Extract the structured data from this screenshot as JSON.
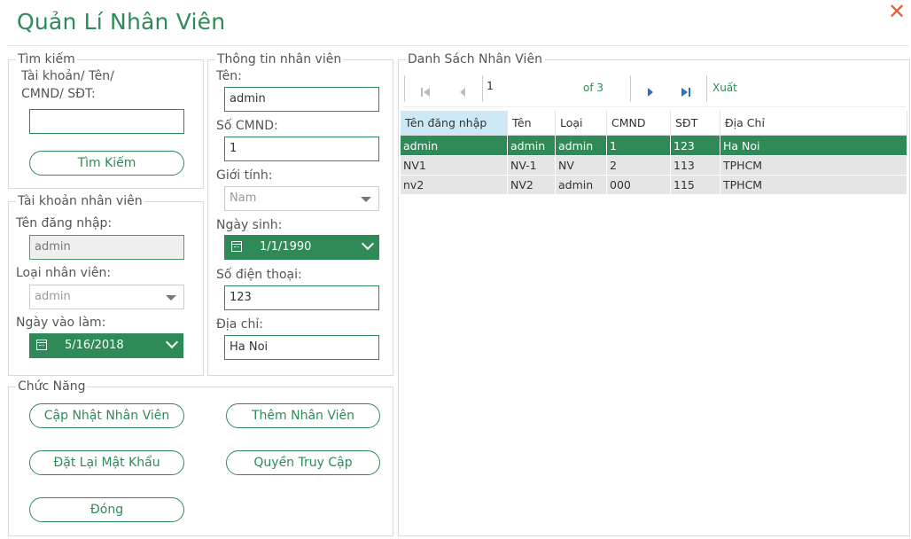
{
  "window": {
    "title": "Quản Lí Nhân Viên",
    "close_label": "✕"
  },
  "search": {
    "group_label": "Tìm kiếm",
    "prompt_line1": "Tài khoản/ Tên/",
    "prompt_line2": "CMND/ SĐT:",
    "input_value": "",
    "button_label": "Tìm Kiếm"
  },
  "account": {
    "group_label": "Tài khoản nhân viên",
    "username_label": "Tên đăng nhập:",
    "username_value": "admin",
    "type_label": "Loại nhân viên:",
    "type_value": "admin",
    "start_date_label": "Ngày vào làm:",
    "start_date_value": "5/16/2018"
  },
  "info": {
    "group_label": "Thông tin nhân viên",
    "name_label": "Tên:",
    "name_value": "admin",
    "id_label": "Số CMND:",
    "id_value": "1",
    "gender_label": "Giới tính:",
    "gender_value": "Nam",
    "dob_label": "Ngày sinh:",
    "dob_value": "1/1/1990",
    "phone_label": "Số điện thoại:",
    "phone_value": "123",
    "address_label": "Địa chỉ:",
    "address_value": "Ha Noi"
  },
  "functions": {
    "group_label": "Chức Năng",
    "update_label": "Cập Nhật Nhân Viên",
    "add_label": "Thêm Nhân Viên",
    "reset_pw_label": "Đặt Lại Mật Khẩu",
    "access_label": "Quyền Truy Cập",
    "close_label": "Đóng"
  },
  "list": {
    "group_label": "Danh Sách Nhân Viên",
    "page_value": "1",
    "page_of": "of 3",
    "export_label": "Xuất",
    "columns": [
      "Tên đăng nhập",
      "Tên",
      "Loại",
      "CMND",
      "SĐT",
      "Địa Chỉ"
    ],
    "rows": [
      [
        "admin",
        "admin",
        "admin",
        "1",
        "123",
        "Ha Noi"
      ],
      [
        "NV1",
        "NV-1",
        "NV",
        "2",
        "113",
        "TPHCM"
      ],
      [
        "nv2",
        "NV2",
        "admin",
        "000",
        "115",
        "TPHCM"
      ]
    ]
  },
  "colors": {
    "accent": "#2e8b57",
    "close": "#e25f3c",
    "header_sorted": "#cde8f7",
    "row_alt": "#e5e5e5"
  }
}
